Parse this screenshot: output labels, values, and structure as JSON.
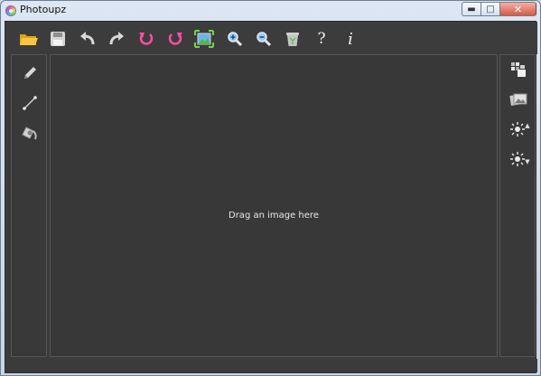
{
  "window": {
    "title": "Photoupz",
    "controls": {
      "minimize": "▬",
      "maximize": "□",
      "close": "✕"
    }
  },
  "toolbar": {
    "buttons": [
      {
        "name": "open-icon",
        "tooltip": ""
      },
      {
        "name": "save-icon"
      },
      {
        "name": "undo-icon"
      },
      {
        "name": "redo-icon"
      },
      {
        "name": "rotate-left-icon"
      },
      {
        "name": "rotate-right-icon"
      },
      {
        "name": "fit-screen-icon"
      },
      {
        "name": "zoom-in-icon"
      },
      {
        "name": "zoom-out-icon"
      },
      {
        "name": "trash-icon"
      },
      {
        "name": "help-icon",
        "glyph": "?"
      },
      {
        "name": "info-icon",
        "glyph": "i"
      }
    ]
  },
  "left_tools": [
    {
      "name": "pencil-icon"
    },
    {
      "name": "line-icon"
    },
    {
      "name": "fill-bucket-icon"
    }
  ],
  "right_tools": [
    {
      "name": "pixelate-icon"
    },
    {
      "name": "photos-icon"
    },
    {
      "name": "brightness-up-icon",
      "arrow": "▲"
    },
    {
      "name": "brightness-down-icon",
      "arrow": "▼"
    }
  ],
  "canvas": {
    "placeholder": "Drag an image here"
  },
  "colors": {
    "background": "#3b3b3b",
    "panel_border": "#555555",
    "accent_pink": "#ff4fa3"
  }
}
